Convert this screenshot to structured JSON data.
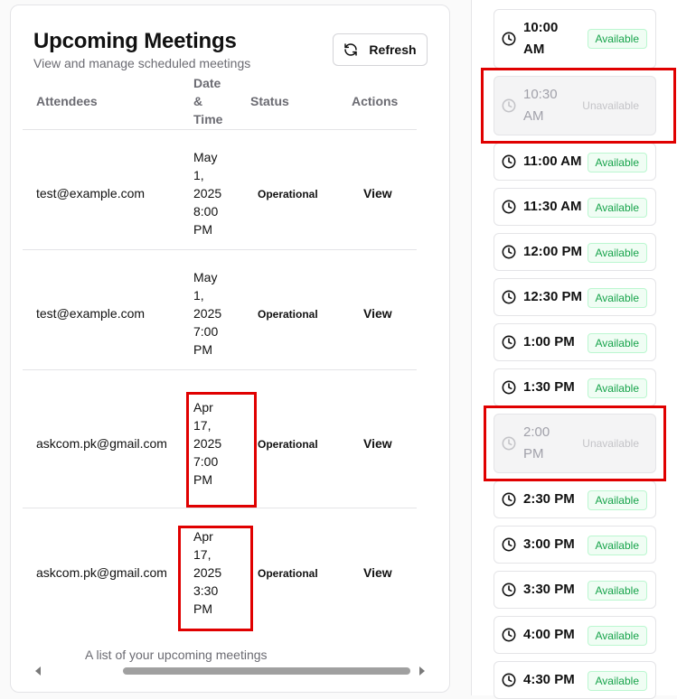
{
  "meetings": {
    "title": "Upcoming Meetings",
    "subtitle": "View and manage scheduled meetings",
    "refresh_label": "Refresh",
    "columns": {
      "attendees": "Attendees",
      "date_time": "Date & Time",
      "status": "Status",
      "actions": "Actions"
    },
    "rows": [
      {
        "attendee": "test@example.com",
        "date_time": "May 1, 2025 8:00 PM",
        "status": "Operational",
        "action": "View"
      },
      {
        "attendee": "test@example.com",
        "date_time": "May 1, 2025 7:00 PM",
        "status": "Operational",
        "action": "View"
      },
      {
        "attendee": "askcom.pk@gmail.com",
        "date_time": "Apr 17, 2025 7:00 PM",
        "status": "Operational",
        "action": "View"
      },
      {
        "attendee": "askcom.pk@gmail.com",
        "date_time": "Apr 17, 2025 3:30 PM",
        "status": "Operational",
        "action": "View"
      }
    ],
    "caption": "A list of your upcoming meetings"
  },
  "time_slots": [
    {
      "time": "10:00 AM",
      "status": "Available"
    },
    {
      "time": "10:30 AM",
      "status": "Unavailable"
    },
    {
      "time": "11:00 AM",
      "status": "Available"
    },
    {
      "time": "11:30 AM",
      "status": "Available"
    },
    {
      "time": "12:00 PM",
      "status": "Available"
    },
    {
      "time": "12:30 PM",
      "status": "Available"
    },
    {
      "time": "1:00 PM",
      "status": "Available"
    },
    {
      "time": "1:30 PM",
      "status": "Available"
    },
    {
      "time": "2:00 PM",
      "status": "Unavailable"
    },
    {
      "time": "2:30 PM",
      "status": "Available"
    },
    {
      "time": "3:00 PM",
      "status": "Available"
    },
    {
      "time": "3:30 PM",
      "status": "Available"
    },
    {
      "time": "4:00 PM",
      "status": "Available"
    },
    {
      "time": "4:30 PM",
      "status": "Available"
    }
  ],
  "colors": {
    "available": "#16a34a",
    "unavailable": "#a1a1aa",
    "highlight": "#e00000"
  }
}
